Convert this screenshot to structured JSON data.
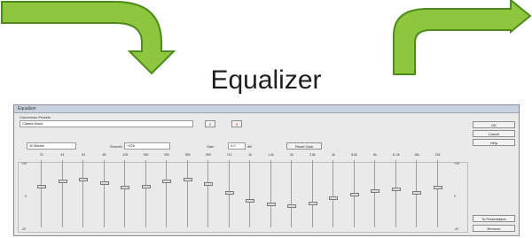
{
  "heading": "Equalizer",
  "colors": {
    "arrow_fill": "#8dc63f",
    "arrow_stroke": "#4e8a1c",
    "dialog_bg": "#eaeaea"
  },
  "dialog": {
    "title": "Equalizer",
    "preset_label": "Conversion Presets",
    "preset_value": "Classic Band",
    "apply_icon_button": "✔",
    "delete_icon_button": "✕",
    "bands_select": "10 Bands",
    "smooth_label": "Smooth",
    "smooth_value": "+10h",
    "gain_label": "Gain",
    "gain_value": "0.0",
    "gain_unit": "dB",
    "reset_button": "Reset Gain",
    "side_buttons": [
      "OK",
      "Cancel",
      "Help"
    ],
    "bottom_buttons": [
      "To Presentation",
      "Remove"
    ],
    "scale_left": [
      "+20",
      "0",
      "-20"
    ],
    "scale_right": [
      "+20",
      "0",
      "-20"
    ],
    "bands": [
      {
        "freq": "31",
        "level": 0.38
      },
      {
        "freq": "44",
        "level": 0.3
      },
      {
        "freq": "63",
        "level": 0.26
      },
      {
        "freq": "88",
        "level": 0.32
      },
      {
        "freq": "125",
        "level": 0.4
      },
      {
        "freq": "180",
        "level": 0.38
      },
      {
        "freq": "250",
        "level": 0.3
      },
      {
        "freq": "355",
        "level": 0.26
      },
      {
        "freq": "500",
        "level": 0.34
      },
      {
        "freq": "710",
        "level": 0.48
      },
      {
        "freq": "1k",
        "level": 0.62
      },
      {
        "freq": "1.4k",
        "level": 0.68
      },
      {
        "freq": "2k",
        "level": 0.7
      },
      {
        "freq": "2.8k",
        "level": 0.66
      },
      {
        "freq": "4k",
        "level": 0.58
      },
      {
        "freq": "5.6k",
        "level": 0.52
      },
      {
        "freq": "8k",
        "level": 0.46
      },
      {
        "freq": "11.2k",
        "level": 0.42
      },
      {
        "freq": "16k",
        "level": 0.48
      },
      {
        "freq": "22k",
        "level": 0.4
      }
    ]
  }
}
